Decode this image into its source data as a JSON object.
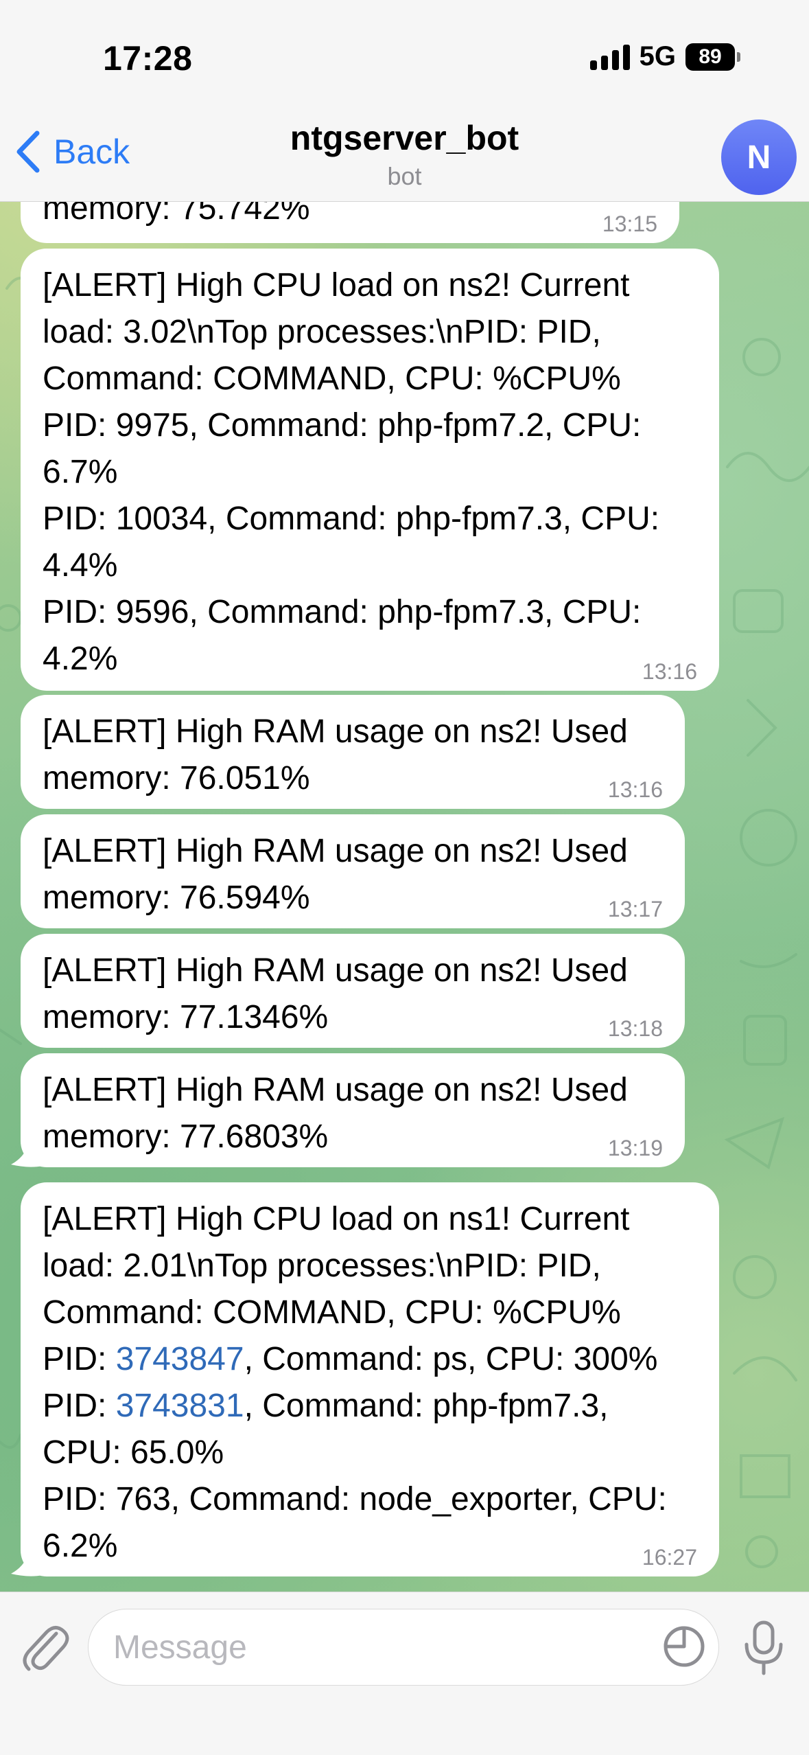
{
  "status_bar": {
    "time": "17:28",
    "network": "5G",
    "battery": "89"
  },
  "header": {
    "back_label": "Back",
    "title": "ntgserver_bot",
    "subtitle": "bot",
    "avatar_letter": "N"
  },
  "messages": [
    {
      "lines": [
        "memory: 75.742%"
      ],
      "time": "13:15"
    },
    {
      "lines": [
        "[ALERT] High CPU load on ns2! Current",
        "load: 3.02\\nTop processes:\\nPID: PID,",
        "Command: COMMAND, CPU: %CPU%",
        "PID: 9975, Command: php-fpm7.2, CPU:",
        "6.7%",
        "PID: 10034, Command: php-fpm7.3, CPU:",
        "4.4%",
        "PID: 9596, Command: php-fpm7.3, CPU:",
        "4.2%"
      ],
      "time": "13:16"
    },
    {
      "lines": [
        "[ALERT] High RAM usage on ns2! Used",
        "memory: 76.051%"
      ],
      "time": "13:16"
    },
    {
      "lines": [
        "[ALERT] High RAM usage on ns2! Used",
        "memory: 76.594%"
      ],
      "time": "13:17"
    },
    {
      "lines": [
        "[ALERT] High RAM usage on ns2! Used",
        "memory: 77.1346%"
      ],
      "time": "13:18"
    },
    {
      "lines": [
        "[ALERT] High RAM usage on ns2! Used",
        "memory: 77.6803%"
      ],
      "time": "13:19"
    },
    {
      "lines": [
        "[ALERT] High CPU load on ns1! Current",
        "load: 2.01\\nTop processes:\\nPID: PID,",
        "Command: COMMAND, CPU: %CPU%"
      ],
      "pid_line_1": {
        "prefix": "PID: ",
        "pid": "3743847",
        "suffix": ", Command: ps, CPU: 300%"
      },
      "pid_line_2": {
        "prefix": "PID: ",
        "pid": "3743831",
        "suffix": ", Command: php-fpm7.3,"
      },
      "tail_lines": [
        "CPU: 65.0%",
        "PID: 763, Command: node_exporter, CPU:",
        "6.2%"
      ],
      "time": "16:27"
    }
  ],
  "input": {
    "placeholder": "Message"
  },
  "colors": {
    "accent": "#2d7cf6",
    "link": "#2f6ab8",
    "bubble": "#ffffff",
    "avatar": "#5a6ff0"
  },
  "icons": [
    "back-chevron-icon",
    "paperclip-icon",
    "sticker-icon",
    "microphone-icon",
    "signal-icon",
    "battery-icon"
  ]
}
